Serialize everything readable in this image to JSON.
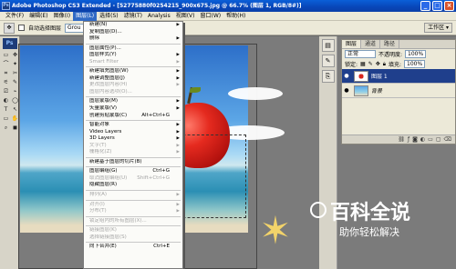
{
  "window": {
    "title": "Adobe Photoshop CS3 Extended - [52775880f0254215_900x675.jpg @ 66.7% (图层 1, RGB/8#)]",
    "app_icon": "Ps",
    "minimize": "_",
    "maximize": "□",
    "close": "×"
  },
  "menubar": {
    "items": [
      "文件(F)",
      "编辑(E)",
      "图像(I)",
      "图层(L)",
      "选择(S)",
      "滤镜(T)",
      "Analysis",
      "视图(V)",
      "窗口(W)",
      "帮助(H)"
    ],
    "active_index": 3
  },
  "options": {
    "auto_select_label": "自动选择图层",
    "auto_select_value": "Grou",
    "workspace_label": "工作区 ▾"
  },
  "tools": {
    "logo": "Ps",
    "icons": [
      "▭",
      "✥",
      "⌒",
      "✦",
      "⌗",
      "✂",
      "⚟",
      "✎",
      "⎚",
      "⌁",
      "◐",
      "◯",
      "T",
      "↖",
      "▭",
      "✋",
      "⌕",
      "◼"
    ]
  },
  "layer_menu": {
    "items": [
      {
        "label": "新建(N)",
        "shortcut": "",
        "submenu": true,
        "disabled": false,
        "sep_after": false
      },
      {
        "label": "复制图层(D)...",
        "shortcut": "",
        "submenu": false,
        "disabled": false,
        "sep_after": false
      },
      {
        "label": "删除",
        "shortcut": "",
        "submenu": true,
        "disabled": false,
        "sep_after": true
      },
      {
        "label": "图层属性(P)...",
        "shortcut": "",
        "submenu": false,
        "disabled": false,
        "sep_after": false
      },
      {
        "label": "图层样式(Y)",
        "shortcut": "",
        "submenu": true,
        "disabled": false,
        "sep_after": false
      },
      {
        "label": "Smart Filter",
        "shortcut": "",
        "submenu": true,
        "disabled": true,
        "sep_after": true
      },
      {
        "label": "新建填充图层(W)",
        "shortcut": "",
        "submenu": true,
        "disabled": false,
        "sep_after": false
      },
      {
        "label": "新建调整图层(J)",
        "shortcut": "",
        "submenu": true,
        "disabled": false,
        "sep_after": false
      },
      {
        "label": "更改图层内容(H)",
        "shortcut": "",
        "submenu": true,
        "disabled": true,
        "sep_after": false
      },
      {
        "label": "图层内容选项(O)...",
        "shortcut": "",
        "submenu": false,
        "disabled": true,
        "sep_after": true
      },
      {
        "label": "图层蒙版(M)",
        "shortcut": "",
        "submenu": true,
        "disabled": false,
        "sep_after": false
      },
      {
        "label": "矢量蒙版(V)",
        "shortcut": "",
        "submenu": true,
        "disabled": false,
        "sep_after": false
      },
      {
        "label": "创建剪贴蒙版(C)",
        "shortcut": "Alt+Ctrl+G",
        "submenu": false,
        "disabled": false,
        "sep_after": true
      },
      {
        "label": "智能对象",
        "shortcut": "",
        "submenu": true,
        "disabled": false,
        "sep_after": false
      },
      {
        "label": "Video Layers",
        "shortcut": "",
        "submenu": true,
        "disabled": false,
        "sep_after": false
      },
      {
        "label": "3D Layers",
        "shortcut": "",
        "submenu": true,
        "disabled": false,
        "sep_after": false
      },
      {
        "label": "文字(T)",
        "shortcut": "",
        "submenu": true,
        "disabled": true,
        "sep_after": false
      },
      {
        "label": "栅格化(Z)",
        "shortcut": "",
        "submenu": true,
        "disabled": true,
        "sep_after": true
      },
      {
        "label": "新建基于图层的切片(B)",
        "shortcut": "",
        "submenu": false,
        "disabled": false,
        "sep_after": true
      },
      {
        "label": "图层编组(G)",
        "shortcut": "Ctrl+G",
        "submenu": false,
        "disabled": false,
        "sep_after": false
      },
      {
        "label": "取消图层编组(U)",
        "shortcut": "Shift+Ctrl+G",
        "submenu": false,
        "disabled": true,
        "sep_after": false
      },
      {
        "label": "隐藏图层(R)",
        "shortcut": "",
        "submenu": false,
        "disabled": false,
        "sep_after": true
      },
      {
        "label": "排列(A)",
        "shortcut": "",
        "submenu": true,
        "disabled": true,
        "sep_after": true
      },
      {
        "label": "对齐(I)",
        "shortcut": "",
        "submenu": true,
        "disabled": true,
        "sep_after": false
      },
      {
        "label": "分布(T)",
        "shortcut": "",
        "submenu": true,
        "disabled": true,
        "sep_after": true
      },
      {
        "label": "锁定组内的所有图层(X)...",
        "shortcut": "",
        "submenu": false,
        "disabled": true,
        "sep_after": true
      },
      {
        "label": "链接图层(K)",
        "shortcut": "",
        "submenu": false,
        "disabled": true,
        "sep_after": false
      },
      {
        "label": "选择链接图层(S)",
        "shortcut": "",
        "submenu": false,
        "disabled": true,
        "sep_after": true
      },
      {
        "label": "向下合并(E)",
        "shortcut": "Ctrl+E",
        "submenu": false,
        "disabled": false,
        "sep_after": false
      }
    ]
  },
  "layers_panel": {
    "tabs": [
      "图层",
      "通道",
      "路径"
    ],
    "blend_mode": "正常",
    "opacity_label": "不透明度:",
    "opacity_value": "100%",
    "lock_label": "锁定:",
    "fill_label": "填充:",
    "fill_value": "100%",
    "layers": [
      {
        "name": "图层 1",
        "selected": true,
        "italic": false
      },
      {
        "name": "背景",
        "selected": false,
        "italic": true
      }
    ]
  },
  "watermark": {
    "title": "百科全说",
    "subtitle": "助你轻松解决"
  }
}
